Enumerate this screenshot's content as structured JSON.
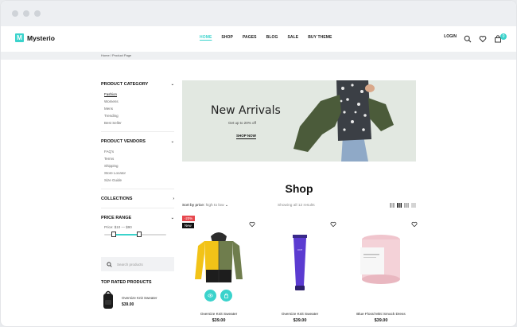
{
  "header": {
    "logo_letter": "M",
    "brand": "Mysterio",
    "nav": [
      "HOME",
      "SHOP",
      "PAGES",
      "BLOG",
      "SALE",
      "BUY THEME"
    ],
    "login": "LOGIN",
    "cart_count": "0"
  },
  "breadcrumb": "Home / Product Page",
  "sidebar": {
    "category_title": "PRODUCT CATEGORY",
    "categories": [
      "Fashion",
      "Womens",
      "Mens",
      "Trending",
      "Best Seller"
    ],
    "vendors_title": "PRODUCT VENDORS",
    "vendors": [
      "FAQ's",
      "Terms",
      "Shipping",
      "Store Locator",
      "Size Guide"
    ],
    "collections_title": "COLLECTIONS",
    "price_title": "PRICE RANGE",
    "price_text": "Price: $10 — $90",
    "search_placeholder": "Search products",
    "top_rated_title": "TOP RATED PRODUCTS",
    "top_rated_item": {
      "name": "Oversize Knit Sweater",
      "price": "$39.00"
    }
  },
  "banner": {
    "title": "New Arrivals",
    "subtitle": "Get up to 20% off",
    "button": "SHOP NOW"
  },
  "shop": {
    "title": "Shop",
    "sort_label": "Sort by price:",
    "sort_value": "high to low",
    "showing": "Showing all 12 results"
  },
  "products": [
    {
      "name": "Oversize Knit Sweater",
      "price": "$39.00",
      "discount": "-20%",
      "badge": "New"
    },
    {
      "name": "Oversize Knit Sweater",
      "price": "$39.00"
    },
    {
      "name": "Blue Floral Mini Smock Dress",
      "price": "$39.00"
    }
  ],
  "colors": {
    "accent": "#3bd3cc",
    "sale": "#e7484f"
  }
}
